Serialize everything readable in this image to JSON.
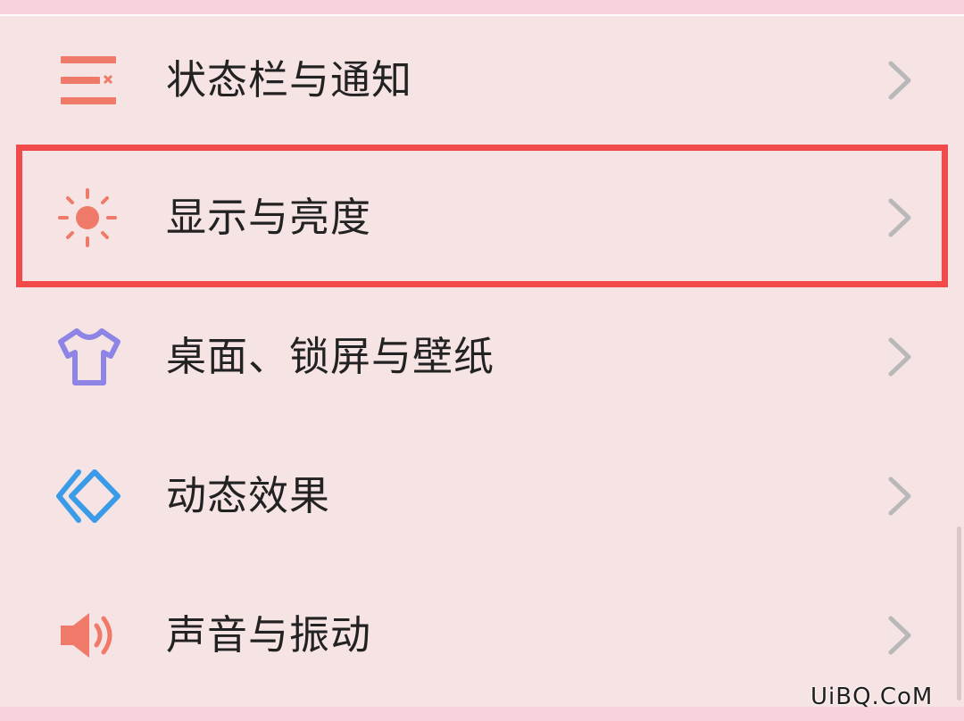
{
  "settings": {
    "items": [
      {
        "label": "状态栏与通知",
        "icon": "status-bar-notification-icon",
        "icon_color": "#f07a6a"
      },
      {
        "label": "显示与亮度",
        "icon": "sun-brightness-icon",
        "icon_color": "#f07a6a"
      },
      {
        "label": "桌面、锁屏与壁纸",
        "icon": "shirt-theme-icon",
        "icon_color": "#8e84e6"
      },
      {
        "label": "动态效果",
        "icon": "diamond-animation-icon",
        "icon_color": "#3a9be8"
      },
      {
        "label": "声音与振动",
        "icon": "speaker-sound-icon",
        "icon_color": "#f07a6a"
      }
    ],
    "highlighted_item": "显示与亮度",
    "highlight_color": "#f24a4b",
    "chevron_color": "#b8b8b8"
  },
  "watermark": "UiBQ.CoM"
}
